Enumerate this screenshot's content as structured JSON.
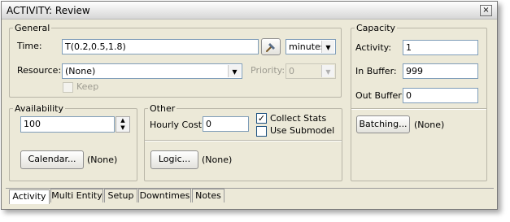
{
  "window": {
    "title": "ACTIVITY: Review",
    "close_glyph": "×"
  },
  "general": {
    "title": "General",
    "time_label": "Time:",
    "time_value": "T(0.2,0.5,1.8)",
    "time_unit": "minutes",
    "resource_label": "Resource:",
    "resource_value": "(None)",
    "priority_label": "Priority:",
    "priority_value": "0",
    "keep_label": "Keep"
  },
  "capacity": {
    "title": "Capacity",
    "activity_label": "Activity:",
    "activity_value": "1",
    "in_buffer_label": "In Buffer:",
    "in_buffer_value": "999",
    "out_buffer_label": "Out Buffer:",
    "out_buffer_value": "0",
    "batching_button": "Batching...",
    "batching_value": "(None)"
  },
  "availability": {
    "title": "Availability",
    "value": "100",
    "calendar_button": "Calendar...",
    "calendar_value": "(None)"
  },
  "other": {
    "title": "Other",
    "hourly_cost_label": "Hourly Cost:",
    "hourly_cost_value": "0",
    "collect_stats_label": "Collect Stats",
    "collect_stats_checked": true,
    "use_submodel_label": "Use Submodel",
    "logic_button": "Logic...",
    "logic_value": "(None)"
  },
  "tabs": [
    {
      "label": "Activity",
      "active": true
    },
    {
      "label": "Multi Entity",
      "active": false
    },
    {
      "label": "Setup",
      "active": false
    },
    {
      "label": "Downtimes",
      "active": false
    },
    {
      "label": "Notes",
      "active": false
    }
  ],
  "icons": {
    "picker": "hammer-icon",
    "dropdown": "chevron-down-icon"
  }
}
